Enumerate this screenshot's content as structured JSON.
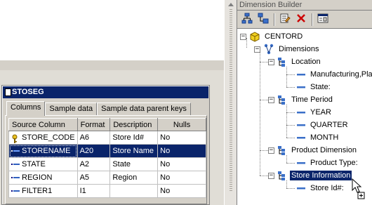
{
  "window": {
    "title": "STOSEG",
    "tabs": [
      {
        "label": "Columns",
        "active": true
      },
      {
        "label": "Sample data",
        "active": false
      },
      {
        "label": "Sample data parent keys",
        "active": false
      }
    ],
    "columns": [
      "Source Column",
      "Format",
      "Description",
      "Nulls"
    ],
    "rows": [
      {
        "name": "STORE_CODE",
        "format": "A6",
        "description": "Store Id#",
        "nulls": "No",
        "icon": "key-icon",
        "selected": false
      },
      {
        "name": "STORENAME",
        "format": "A20",
        "description": "Store Name",
        "nulls": "No",
        "icon": "column-icon",
        "selected": true
      },
      {
        "name": "STATE",
        "format": "A2",
        "description": "State",
        "nulls": "No",
        "icon": "column-icon",
        "selected": false
      },
      {
        "name": "REGION",
        "format": "A5",
        "description": "Region",
        "nulls": "No",
        "icon": "column-icon",
        "selected": false
      },
      {
        "name": "FILTER1",
        "format": "I1",
        "description": "",
        "nulls": "No",
        "icon": "column-icon",
        "selected": false
      }
    ]
  },
  "builder": {
    "title": "Dimension Builder",
    "toolbar": [
      {
        "icon": "add-hierarchy-icon"
      },
      {
        "icon": "add-level-icon"
      },
      {
        "icon": "properties-icon"
      },
      {
        "icon": "delete-icon"
      },
      {
        "icon": "dialog-icon"
      }
    ],
    "tree": {
      "root": "CENTORD",
      "dimensions_label": "Dimensions",
      "items": [
        {
          "label": "Location",
          "children": [
            "Manufacturing,Plar",
            "State:"
          ]
        },
        {
          "label": "Time Period",
          "children": [
            "YEAR",
            "QUARTER",
            "MONTH"
          ]
        },
        {
          "label": "Product Dimension",
          "children": [
            "Product Type:"
          ]
        },
        {
          "label": "Store Information",
          "children": [
            "Store Id#:"
          ],
          "selected": true
        }
      ]
    }
  },
  "colors": {
    "selection": "#0a246a",
    "face": "#d4d0c8",
    "delete": "#cc0000"
  }
}
